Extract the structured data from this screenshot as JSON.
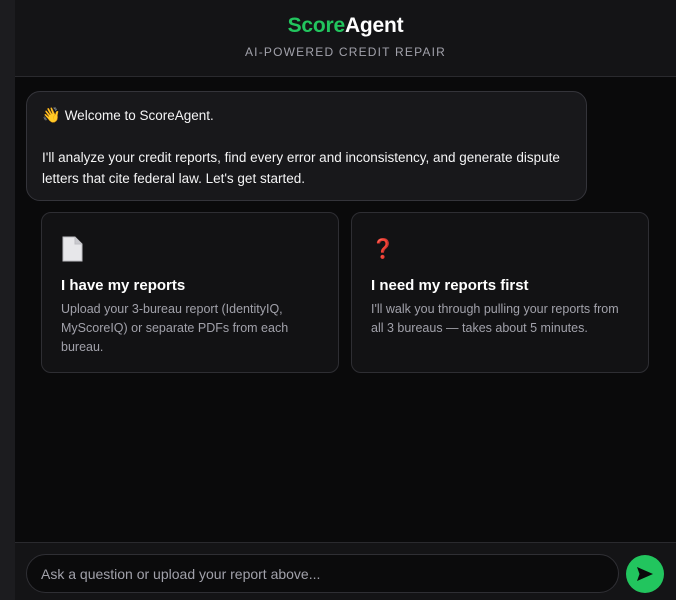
{
  "header": {
    "brand_score": "Score",
    "brand_agent": "Agent",
    "tagline": "AI-POWERED CREDIT REPAIR"
  },
  "welcome": {
    "wave_emoji": "👋",
    "line1": "Welcome to ScoreAgent.",
    "line2": "I'll analyze your credit reports, find every error and inconsistency, and generate dispute letters that cite federal law. Let's get started."
  },
  "cards": [
    {
      "icon": "document-icon",
      "title": "I have my reports",
      "description": "Upload your 3-bureau report (IdentityIQ, MyScoreIQ) or separate PDFs from each bureau."
    },
    {
      "icon": "question-mark-icon",
      "icon_glyph": "❓",
      "title": "I need my reports first",
      "description": "I'll walk you through pulling your reports from all 3 bureaus — takes about 5 minutes."
    }
  ],
  "composer": {
    "placeholder": "Ask a question or upload your report above...",
    "value": ""
  },
  "colors": {
    "accent": "#22c55e",
    "background": "#0a0a0b",
    "question_red": "#e11d2a"
  }
}
